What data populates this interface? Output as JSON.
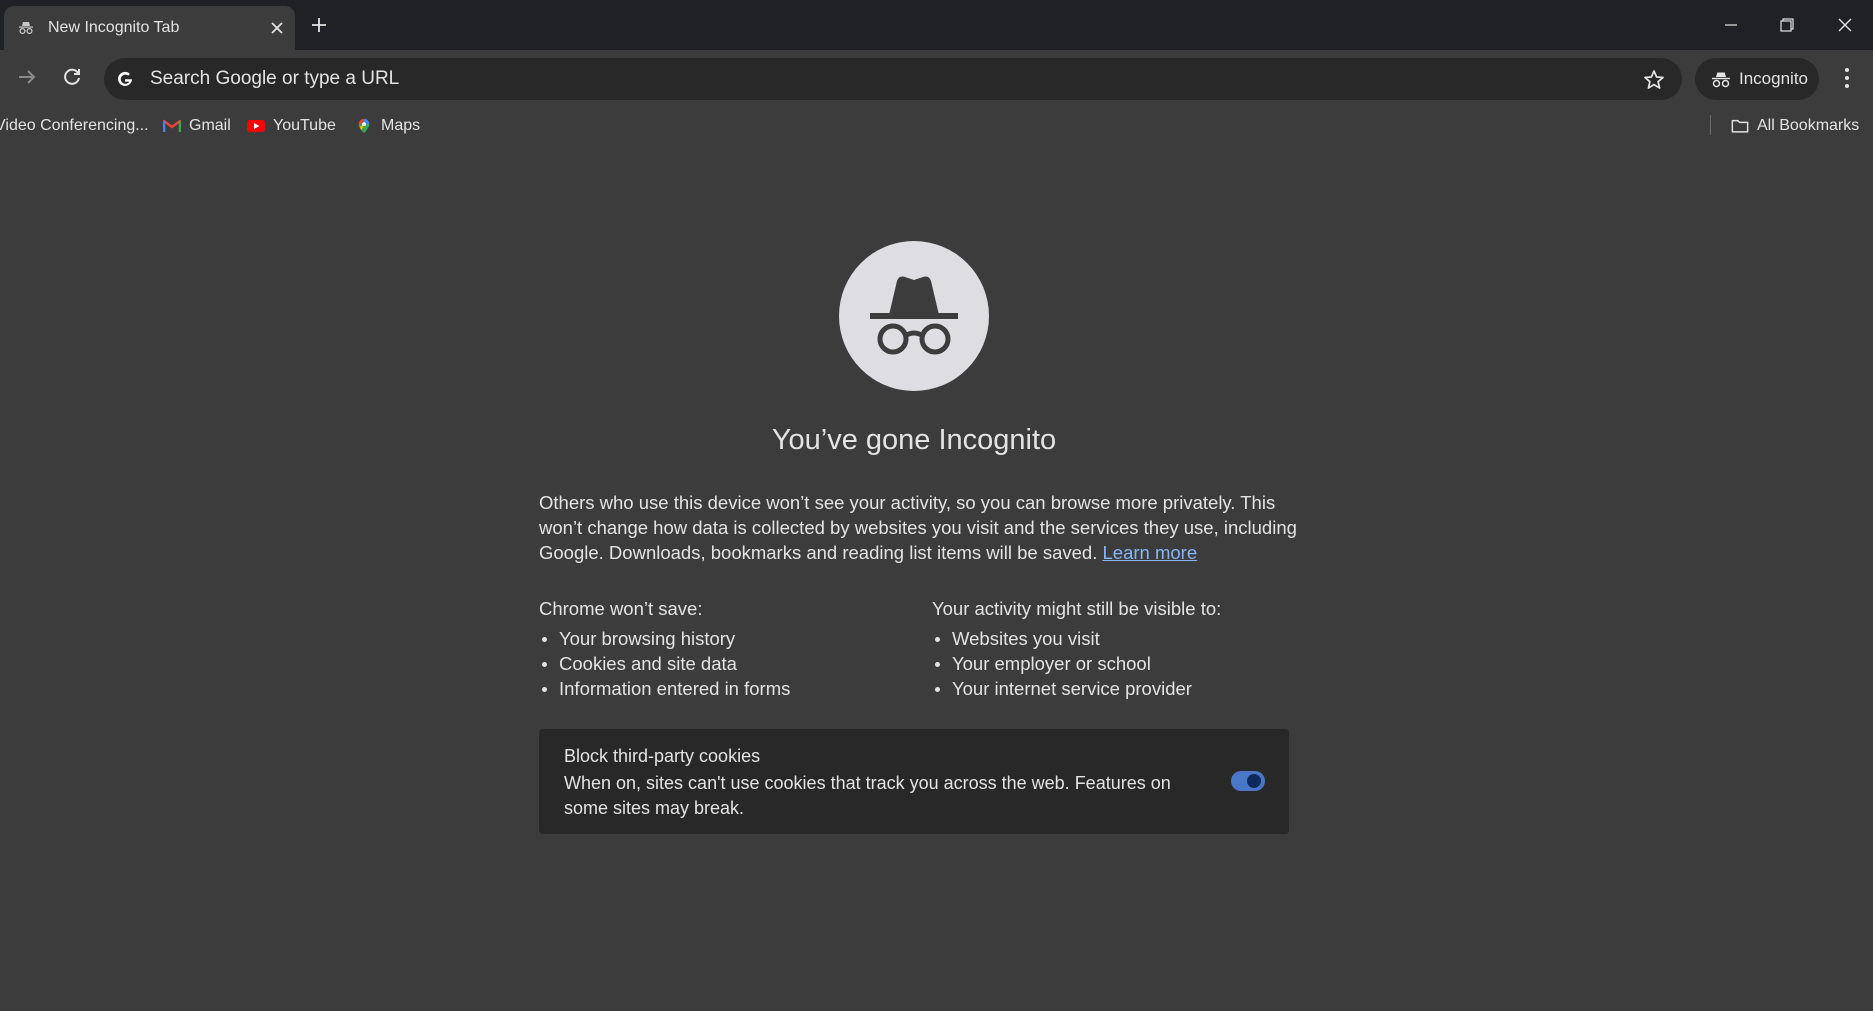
{
  "tab": {
    "title": "New Incognito Tab",
    "icon": "incognito-icon"
  },
  "toolbar": {
    "omnibox_placeholder": "Search Google or type a URL",
    "incognito_label": "Incognito"
  },
  "bookmarks": {
    "items": [
      {
        "label": "Video Conferencing...",
        "icon": "none"
      },
      {
        "label": "Gmail",
        "icon": "gmail-icon"
      },
      {
        "label": "YouTube",
        "icon": "youtube-icon"
      },
      {
        "label": "Maps",
        "icon": "maps-icon"
      }
    ],
    "all_label": "All Bookmarks"
  },
  "main": {
    "heading": "You’ve gone Incognito",
    "intro": "Others who use this device won’t see your activity, so you can browse more privately. This won’t change how data is collected by websites you visit and the services they use, including Google. Downloads, bookmarks and reading list items will be saved.",
    "learn_more": "Learn more",
    "wont_save": {
      "title": "Chrome won’t save:",
      "items": [
        "Your browsing history",
        "Cookies and site data",
        "Information entered in forms"
      ]
    },
    "still_visible": {
      "title": "Your activity might still be visible to:",
      "items": [
        "Websites you visit",
        "Your employer or school",
        "Your internet service provider"
      ]
    },
    "cookies": {
      "title": "Block third-party cookies",
      "description": "When on, sites can't use cookies that track you across the web. Features on some sites may break.",
      "enabled": true
    }
  },
  "colors": {
    "page_bg": "#3c3c3c",
    "tabstrip_bg": "#202124",
    "omnibox_bg": "#282828",
    "link": "#8ab4f8",
    "toggle_track": "#4a76c7"
  }
}
